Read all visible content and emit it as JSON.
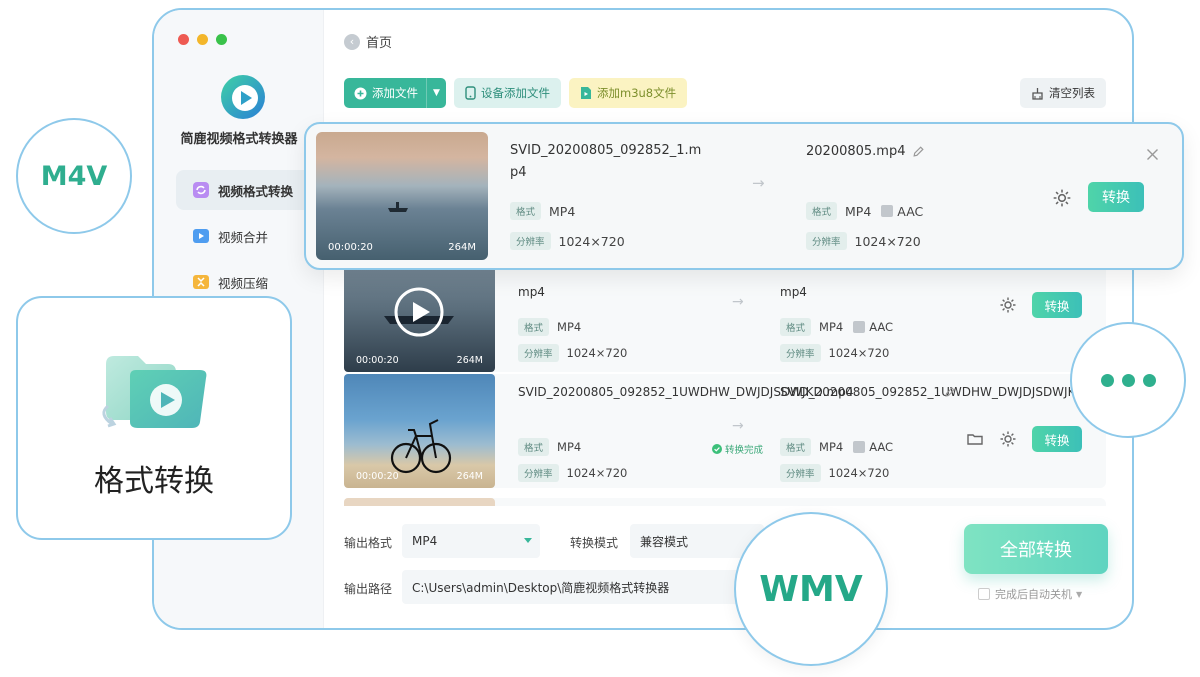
{
  "app": {
    "name": "简鹿视频格式转换器",
    "traffic_colors": [
      "#ee5a52",
      "#f3b62a",
      "#39c24a"
    ],
    "accent": "#38b79a"
  },
  "nav": {
    "items": [
      {
        "label": "视频格式转换",
        "active": true,
        "icon": "convert-icon"
      },
      {
        "label": "视频合并",
        "active": false,
        "icon": "merge-icon"
      },
      {
        "label": "视频压缩",
        "active": false,
        "icon": "compress-icon"
      }
    ]
  },
  "header": {
    "home": "首页"
  },
  "toolbar": {
    "add_file": "添加文件",
    "device_add": "设备添加文件",
    "add_m3u8": "添加m3u8文件",
    "clear_list": "清空列表"
  },
  "files": [
    {
      "src_name": "SVID_20200805_092852_1.mp4",
      "dst_name": "20200805.mp4",
      "format_label": "格式",
      "format": "MP4",
      "res_label": "分辨率",
      "resolution": "1024×720",
      "dst_format": "MP4",
      "audio": "AAC",
      "dst_resolution": "1024×720",
      "duration": "00:00:20",
      "size": "264M",
      "convert_label": "转换"
    },
    {
      "src_name": "mp4",
      "dst_name": "mp4",
      "format_label": "格式",
      "format": "MP4",
      "res_label": "分辨率",
      "resolution": "1024×720",
      "dst_format": "MP4",
      "audio": "AAC",
      "dst_resolution": "1024×720",
      "duration": "00:00:20",
      "size": "264M",
      "convert_label": "转换"
    },
    {
      "src_name": "SVID_20200805_092852_1UWDHW_DWJDJSDWJKD.mp4",
      "dst_name": "SVID_20200805_092852_1UWDHW_DWJDJSDWJKD...",
      "format_label": "格式",
      "format": "MP4",
      "res_label": "分辨率",
      "resolution": "1024×720",
      "dst_format": "MP4",
      "audio": "AAC",
      "dst_resolution": "1024×720",
      "duration": "00:00:20",
      "size": "264M",
      "status": "转换完成",
      "convert_label": "转换"
    }
  ],
  "bottom": {
    "output_format_label": "输出格式",
    "output_format_value": "MP4",
    "convert_mode_label": "转换模式",
    "convert_mode_value": "兼容模式",
    "output_path_label": "输出路径",
    "output_path_value": "C:\\Users\\admin\\Desktop\\简鹿视频格式转换器",
    "convert_all": "全部转换",
    "auto_shutdown": "完成后自动关机"
  },
  "badges": {
    "m4v": "M4V",
    "wmv": "WMV",
    "feature": "格式转换"
  }
}
